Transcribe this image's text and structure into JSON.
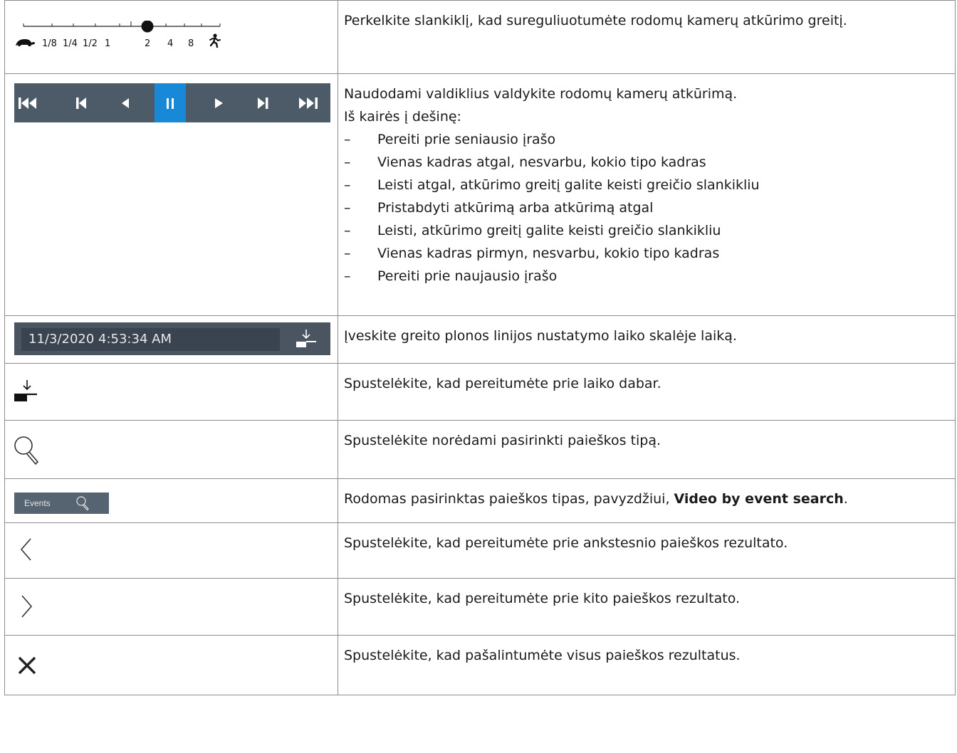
{
  "speed_slider": {
    "tick_labels": [
      "1/8",
      "1/4",
      "1/2",
      "1",
      "2",
      "4",
      "8"
    ],
    "selected_value": "2"
  },
  "playback": {
    "selected_button": "pause"
  },
  "time_field": {
    "value": "11/3/2020 4:53:34 AM"
  },
  "events_button": {
    "label": "Events"
  },
  "rows": [
    {
      "text": "Perkelkite slankiklį, kad sureguliuotumėte rodomų kamerų atkūrimo greitį."
    },
    {
      "intro1": "Naudodami valdiklius valdykite rodomų kamerų atkūrimą.",
      "intro2": "Iš kairės į dešinę:",
      "items": [
        "Pereiti prie seniausio įrašo",
        "Vienas kadras atgal, nesvarbu, kokio tipo kadras",
        "Leisti atgal, atkūrimo greitį galite keisti greičio slankikliu",
        "Pristabdyti atkūrimą arba atkūrimą atgal",
        "Leisti, atkūrimo greitį galite keisti greičio slankikliu",
        "Vienas kadras pirmyn, nesvarbu, kokio tipo kadras",
        "Pereiti prie naujausio įrašo"
      ]
    },
    {
      "text": "Įveskite greito plonos linijos nustatymo laiko skalėje laiką."
    },
    {
      "text": "Spustelėkite, kad pereitumėte prie laiko dabar."
    },
    {
      "text": "Spustelėkite norėdami pasirinkti paieškos tipą."
    },
    {
      "text_before": "Rodomas pasirinktas paieškos tipas, pavyzdžiui, ",
      "bold": "Video by event search",
      "text_after": "."
    },
    {
      "text": "Spustelėkite, kad pereitumėte prie ankstesnio paieškos rezultato."
    },
    {
      "text": "Spustelėkite, kad pereitumėte prie kito paieškos rezultato."
    },
    {
      "text": "Spustelėkite, kad pašalintumėte visus paieškos rezultatus."
    }
  ]
}
